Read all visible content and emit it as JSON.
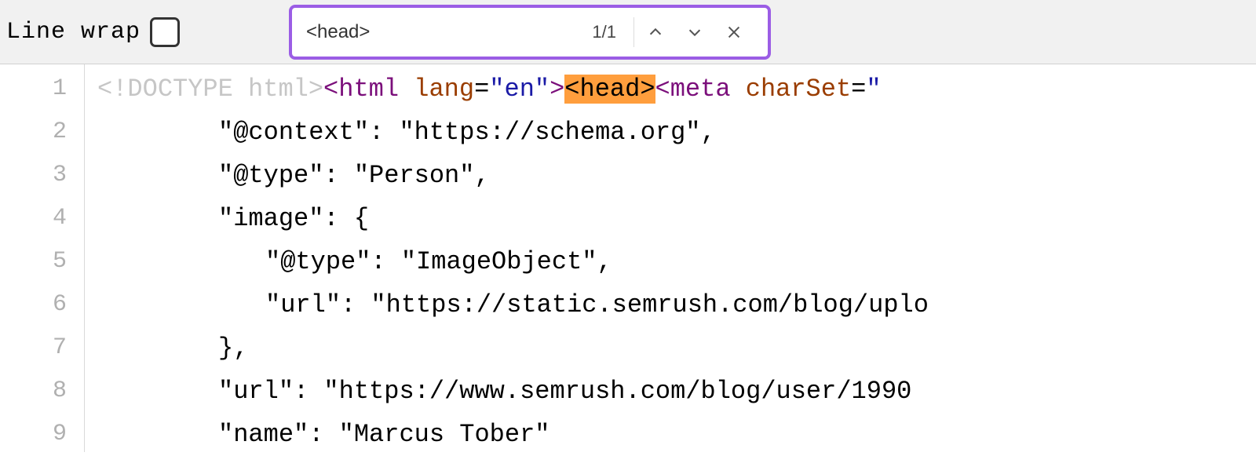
{
  "toolbar": {
    "linewrap_label": "Line wrap"
  },
  "search": {
    "query": "<head>",
    "count": "1/1"
  },
  "code": {
    "line_numbers": [
      "1",
      "2",
      "3",
      "4",
      "5",
      "6",
      "7",
      "8",
      "9"
    ],
    "line1": {
      "doctype": "<!DOCTYPE html>",
      "html_open": "<html",
      "lang_attr": " lang",
      "eq1": "=",
      "lang_val": "\"en\"",
      "html_close": ">",
      "head_tag": "<head>",
      "meta_open": "<meta",
      "charset_attr": " charSet",
      "eq2": "=",
      "charset_val": "\""
    },
    "line2": "\"@context\": \"https://schema.org\",",
    "line3": "\"@type\": \"Person\",",
    "line4": "\"image\": {",
    "line5": "\"@type\": \"ImageObject\",",
    "line6": "\"url\": \"https://static.semrush.com/blog/uplo",
    "line7": "},",
    "line8": "\"url\": \"https://www.semrush.com/blog/user/1990",
    "line9": "\"name\": \"Marcus Tober\""
  }
}
